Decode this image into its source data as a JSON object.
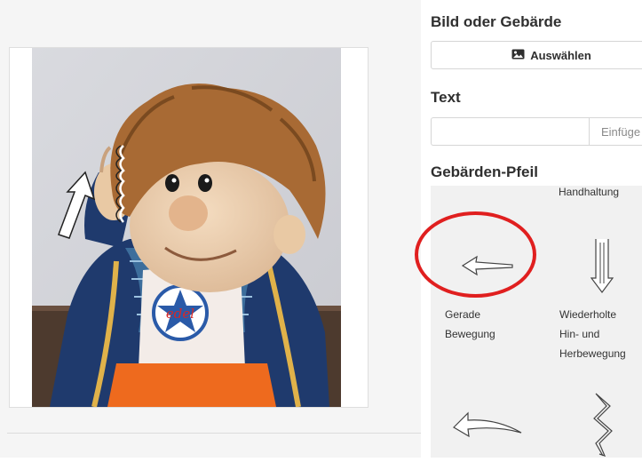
{
  "image_section": {
    "title": "Bild oder Gebärde",
    "choose_button_label": "Auswählen"
  },
  "text_section": {
    "title": "Text",
    "input_value": "",
    "insert_button_label": "Einfüge"
  },
  "arrow_section": {
    "title": "Gebärden-Pfeil",
    "tiles": [
      {
        "label": "Handhaltung",
        "icon": "hand-position-icon"
      },
      {
        "label": "Gerade Bewegung",
        "label_line1": "Gerade",
        "label_line2": "Bewegung",
        "icon": "straight-arrow-icon"
      },
      {
        "label": "Wiederholte Hin- und Herbewegung",
        "label_line1": "Wiederholte",
        "label_line2": "Hin- und",
        "label_line3": "Herbewegung",
        "icon": "back-and-forth-arrow-icon"
      },
      {
        "label": "",
        "icon": "curved-arrow-icon"
      },
      {
        "label": "",
        "icon": "zigzag-arrow-icon"
      }
    ]
  },
  "canvas": {
    "photo_subject": "hand-puppet-photo",
    "shirt_logo_text": "edel",
    "overlay_symbols": [
      "up-arrow-icon",
      "wave-marks-icon"
    ]
  },
  "highlight": {
    "color": "#e01f1f",
    "target": "straight-arrow-tile"
  },
  "colors": {
    "panel_bg": "#f5f5f5",
    "grid_bg": "#f1f1f1",
    "border": "#d6d6d6"
  }
}
